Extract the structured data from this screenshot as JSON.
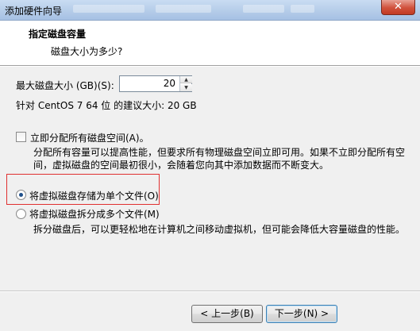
{
  "window": {
    "title": "添加硬件向导",
    "close_label": "✕"
  },
  "header": {
    "title": "指定磁盘容量",
    "subtitle": "磁盘大小为多少?"
  },
  "disk_size": {
    "label": "最大磁盘大小 (GB)(S):",
    "value": "20",
    "recommendation": "针对 CentOS 7 64 位 的建议大小: 20 GB"
  },
  "allocate": {
    "label": "立即分配所有磁盘空间(A)。",
    "checked": false,
    "desc_line1": "分配所有容量可以提高性能，但要求所有物理磁盘空间立即可用。如果不立即分配所有空",
    "desc_line2": "间，虚拟磁盘的空间最初很小，会随着您向其中添加数据而不断变大。"
  },
  "storage": {
    "single_label": "将虚拟磁盘存储为单个文件(O)",
    "multi_label": "将虚拟磁盘拆分成多个文件(M)",
    "selected": "single",
    "multi_desc": "拆分磁盘后，可以更轻松地在计算机之间移动虚拟机，但可能会降低大容量磁盘的性能。"
  },
  "buttons": {
    "back": "< 上一步(B)",
    "next": "下一步(N) >"
  }
}
